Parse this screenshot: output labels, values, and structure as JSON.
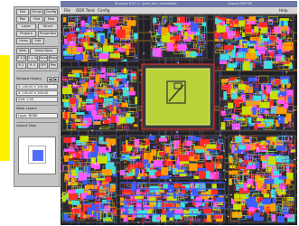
{
  "colors": {
    "hint_bar": "#fff200",
    "panel_bg": "#c4c4c4",
    "title_bar": "#6e79a8",
    "canvas_bg": "#222025",
    "poly": "#ff2a2a",
    "metal1": "#3f5cff",
    "metal2": "#ff9e00",
    "diffusion": "#c8e000",
    "via": "#ffffff",
    "pad": "#b8d23a"
  },
  "side_panel": {
    "row1": [
      "Dst",
      "Chmpr",
      "Config"
    ],
    "row2": [
      "Pan",
      "Find",
      "Mea"
    ],
    "row3": [
      "Layer",
      "Struct"
    ],
    "row4": [
      "Prepare",
      "Properties"
    ],
    "row5": [
      "Undo",
      "Edit"
    ],
    "row6": [
      "Hidn",
      "Show None"
    ],
    "row7": [
      "R 1/2",
      "2 x 2x",
      "Save",
      "Repeat"
    ],
    "row8": [
      "R 2",
      "R 4",
      "OFF",
      "Pan"
    ],
    "window_history_label": "Window History",
    "field1": "X: 100.00  Y: 200.00",
    "field2": "X: 100.00  Y: 200.00",
    "field3": "Grid: 1.00",
    "mesh_layers_label": "Mesh Layers",
    "layer_label": "Layer: NONE",
    "layout_preview_label": "Layout View",
    "icons": {
      "history_back": "chevron-left-icon",
      "history_forward": "chevron-right-icon"
    }
  },
  "main_window": {
    "title_left": "KLayout 0.27.1 - [cell] top / schematic",
    "title_right": "Layout EDITOR",
    "menu": [
      "File",
      "ODR Tools",
      "Config"
    ],
    "menu_right": "Help"
  }
}
